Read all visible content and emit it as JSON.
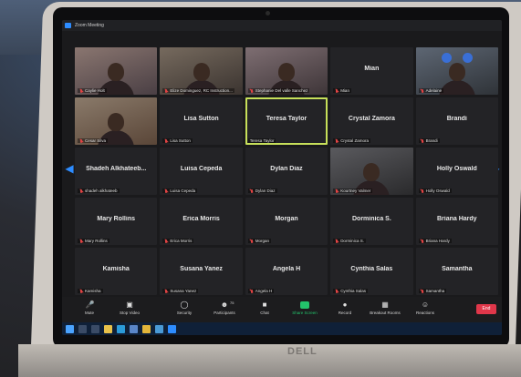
{
  "window": {
    "title": "Zoom Meeting"
  },
  "nav": {
    "prev_icon": "chevron-left-icon",
    "next_icon": "chevron-right-icon"
  },
  "participants": [
    {
      "name": "",
      "label": "Caylie Holt",
      "video": true,
      "muted": true
    },
    {
      "name": "",
      "label": "Elize Dominguez, RC Instruction...",
      "video": true,
      "muted": true
    },
    {
      "name": "",
      "label": "Stephanie Del valle Sanchez",
      "video": true,
      "muted": true
    },
    {
      "name": "Mian",
      "label": "Mian",
      "video": false,
      "muted": true
    },
    {
      "name": "",
      "label": "Adelaine",
      "video": true,
      "muted": true
    },
    {
      "name": "",
      "label": "Cesar Silva",
      "video": true,
      "muted": true
    },
    {
      "name": "Lisa Sutton",
      "label": "Lisa Sutton",
      "video": false,
      "muted": true
    },
    {
      "name": "Teresa Taylor",
      "label": "Teresa Taylor",
      "video": false,
      "muted": false,
      "active_speaker": true
    },
    {
      "name": "Crystal Zamora",
      "label": "Crystal Zamora",
      "video": false,
      "muted": true
    },
    {
      "name": "Brandi",
      "label": "Brandi",
      "video": false,
      "muted": true
    },
    {
      "name": "Shadeh Alkhateeb...",
      "label": "shadeh alkhateeb",
      "video": false,
      "muted": true
    },
    {
      "name": "Luisa Cepeda",
      "label": "Luisa Cepeda",
      "video": false,
      "muted": true
    },
    {
      "name": "Dylan Diaz",
      "label": "Dylan Diaz",
      "video": false,
      "muted": true
    },
    {
      "name": "",
      "label": "Kourtney Valmer",
      "video": true,
      "muted": true
    },
    {
      "name": "Holly Oswald",
      "label": "Holly Oswald",
      "video": false,
      "muted": true
    },
    {
      "name": "Mary Rollins",
      "label": "Mary Rollins",
      "video": false,
      "muted": true
    },
    {
      "name": "Erica Morris",
      "label": "Erica Morris",
      "video": false,
      "muted": true
    },
    {
      "name": "Morgan",
      "label": "Morgan",
      "video": false,
      "muted": true
    },
    {
      "name": "Dorminica S.",
      "label": "Dorminica S.",
      "video": false,
      "muted": true
    },
    {
      "name": "Briana Hardy",
      "label": "Briana Hardy",
      "video": false,
      "muted": true
    },
    {
      "name": "Kamisha",
      "label": "Kamisha",
      "video": false,
      "muted": true
    },
    {
      "name": "Susana Yanez",
      "label": "Susana Yanez",
      "video": false,
      "muted": true
    },
    {
      "name": "Angela H",
      "label": "Angela H",
      "video": false,
      "muted": true
    },
    {
      "name": "Cynthia Salas",
      "label": "Cynthia Salas",
      "video": false,
      "muted": true
    },
    {
      "name": "Samantha",
      "label": "Samantha",
      "video": false,
      "muted": true
    }
  ],
  "toolbar": {
    "mute": "Mute",
    "stop_video": "Stop Video",
    "security": "Security",
    "participants": "Participants",
    "participants_count": "75",
    "chat": "Chat",
    "share_screen": "Share Screen",
    "record": "Record",
    "breakout_rooms": "Breakout Rooms",
    "reactions": "Reactions",
    "end": "End"
  },
  "colors": {
    "accent": "#2d8cff",
    "active_speaker": "#c7e05a",
    "share": "#23c26b",
    "end": "#e0374a",
    "muted": "#e04545"
  },
  "brand": "DELL"
}
